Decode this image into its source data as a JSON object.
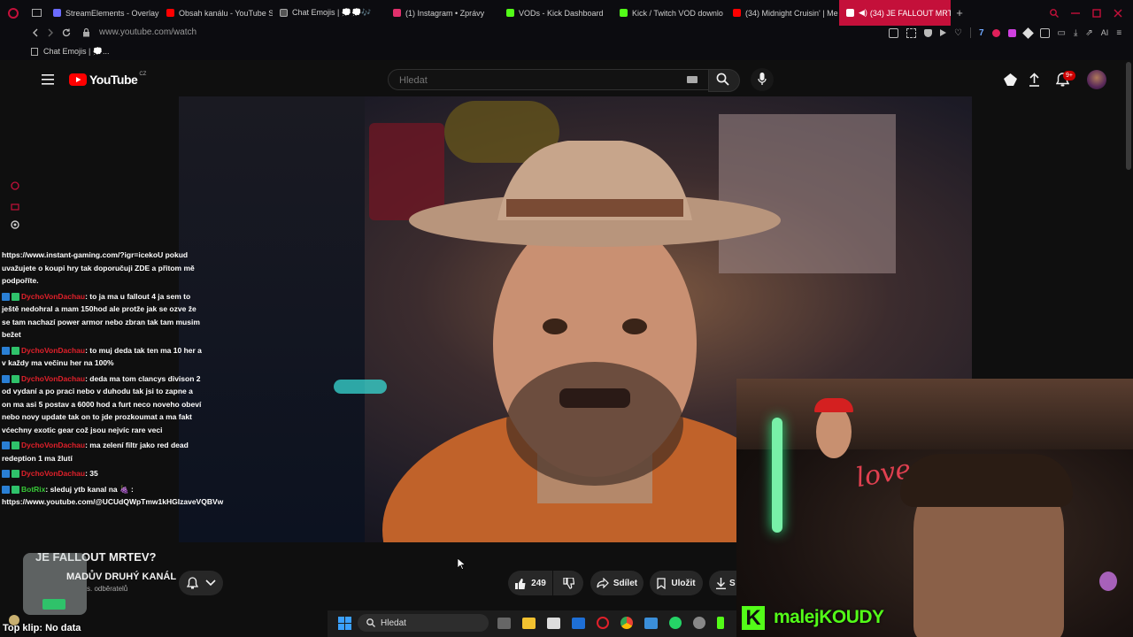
{
  "browser": {
    "tabs": [
      {
        "label": "StreamElements - Overlay",
        "color": "#6b6bff"
      },
      {
        "label": "Obsah kanálu - YouTube S",
        "color": "#ff0000"
      },
      {
        "label": "Chat Emojis | 💭💭🎶",
        "color": "#7c7c7c"
      },
      {
        "label": "(1) Instagram • Zprávy",
        "color": "#e1306c"
      },
      {
        "label": "VODs - Kick Dashboard",
        "color": "#53fc18"
      },
      {
        "label": "Kick / Twitch VOD downlo",
        "color": "#53fc18"
      },
      {
        "label": "(34) Midnight Cruisin' | Me",
        "color": "#ff0000"
      },
      {
        "label": "(34) JE FALLOUT MRT",
        "color": "#ffffff"
      }
    ],
    "url": "www.youtube.com/watch",
    "bookmark": "Chat Emojis | 💭..."
  },
  "youtube": {
    "logo_text": "YouTube",
    "country": "CZ",
    "search_placeholder": "Hledat",
    "notifications_badge": "9+"
  },
  "chat": {
    "messages": [
      {
        "nick": "",
        "text": "https://www.instant-gaming.com/?igr=icekoU pokud uvažujete o koupi hry tak doporučuji ZDE a přitom mě podpoříte."
      },
      {
        "nick": "DychoVonDachau",
        "text": ": to ja ma u fallout 4 ja sem to ještě nedohral a mam 150hod ale protže jak se ozve že se tam nachazí power armor nebo zbran tak tam musim bežet"
      },
      {
        "nick": "DychoVonDachau",
        "text": ": to muj deda tak ten ma 10 her a v každy ma večinu her na 100%"
      },
      {
        "nick": "DychoVonDachau",
        "text": ": deda ma tom clancys divison 2 od vydaní a po praci nebo v duhodu tak jsi to zapne a on ma asi 5 postav a 6000 hod a furt neco noveho obeví nebo novy update tak on to jde prozkoumat a ma fakt vćechny exotic gear což jsou nejvíc rare veci"
      },
      {
        "nick": "DychoVonDachau",
        "text": ": ma zelení filtr jako red dead redeption 1 ma žlutí"
      },
      {
        "nick": "DychoVonDachau",
        "text": ": 35"
      },
      {
        "nick": "BotRix",
        "text": ": sleduj ytb kanal na 🍇 : https://www.youtube.com/@UCUdQWpTmw1kHGIzaveVQBVw"
      }
    ]
  },
  "video": {
    "title": "JE FALLOUT MRTEV?",
    "channel": "MADŮV DRUHÝ KANÁL",
    "subscribers": "s. odběratelů",
    "likes": "249",
    "share_label": "Sdílet",
    "save_label": "Uložit",
    "download_label": "S"
  },
  "overlay": {
    "streamer_name": "malejKOUDY",
    "love_sign": "love",
    "clip_status": "Top klip: No data"
  },
  "taskbar": {
    "search_placeholder": "Hledat"
  },
  "colors": {
    "accent_red": "#c4103a",
    "yt_red": "#ff0000",
    "kick_green": "#53fc18",
    "nick_red": "#e0202a"
  }
}
